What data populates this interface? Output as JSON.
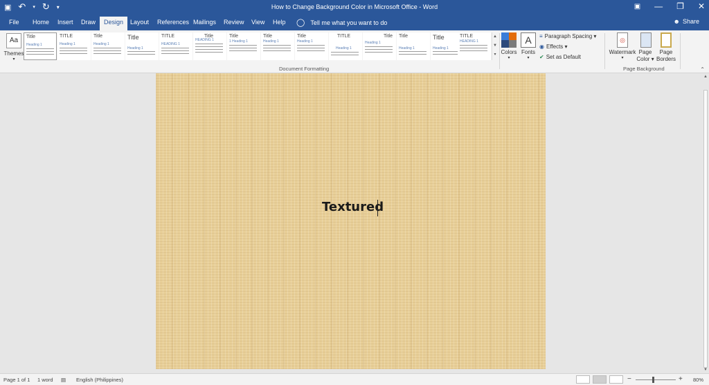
{
  "titlebar": {
    "title": "How to Change Background Color in Microsoft Office  -  Word",
    "qat": {
      "save_icon": "💾",
      "undo_icon": "↶",
      "redo_icon": "↻"
    },
    "controls": {
      "minimize": "—",
      "restore": "❐",
      "close": "✕"
    }
  },
  "tabs": {
    "file": "File",
    "home": "Home",
    "insert": "Insert",
    "draw": "Draw",
    "design": "Design",
    "layout": "Layout",
    "references": "References",
    "mailings": "Mailings",
    "review": "Review",
    "view": "View",
    "help": "Help",
    "tell_me": "Tell me what you want to do",
    "share": "Share"
  },
  "ribbon": {
    "themes": "Themes",
    "gallery": [
      {
        "title": "Title",
        "heading": "Heading 1"
      },
      {
        "title": "TITLE",
        "heading": "Heading 1"
      },
      {
        "title": "Title",
        "heading": "Heading 1"
      },
      {
        "title": "Title",
        "heading": "Heading 1"
      },
      {
        "title": "TITLE",
        "heading": "HEADING 1"
      },
      {
        "title": "Title",
        "heading": "HEADING 1"
      },
      {
        "title": "Title",
        "heading": "1   Heading 1"
      },
      {
        "title": "Title",
        "heading": "Heading 1"
      },
      {
        "title": "Title",
        "heading": "Heading 1"
      },
      {
        "title": "TITLE",
        "heading": "Heading 1"
      },
      {
        "title": "Title",
        "heading": "Heading 1"
      },
      {
        "title": "Title",
        "heading": "Heading 1"
      },
      {
        "title": "Title",
        "heading": "Heading 1"
      },
      {
        "title": "TITLE",
        "heading": "HEADING 1"
      }
    ],
    "document_formatting_label": "Document Formatting",
    "colors": "Colors",
    "fonts": "Fonts",
    "fonts_glyph": "A",
    "paragraph_spacing": "Paragraph Spacing ▾",
    "effects": "Effects ▾",
    "set_as_default": "Set as Default",
    "watermark": "Watermark",
    "page_color": "Page Color ▾",
    "page_borders": "Page Borders",
    "page_background_label": "Page Background",
    "theme_colors": [
      "#3b7dd8",
      "#e36c0a",
      "#2c4a7c",
      "#7a7a7a"
    ]
  },
  "document": {
    "text": "Textured",
    "page_color": "#e8cf98"
  },
  "status": {
    "page": "Page 1 of 1",
    "words": "1 word",
    "language": "English (Philippines)",
    "zoom": "80%"
  }
}
